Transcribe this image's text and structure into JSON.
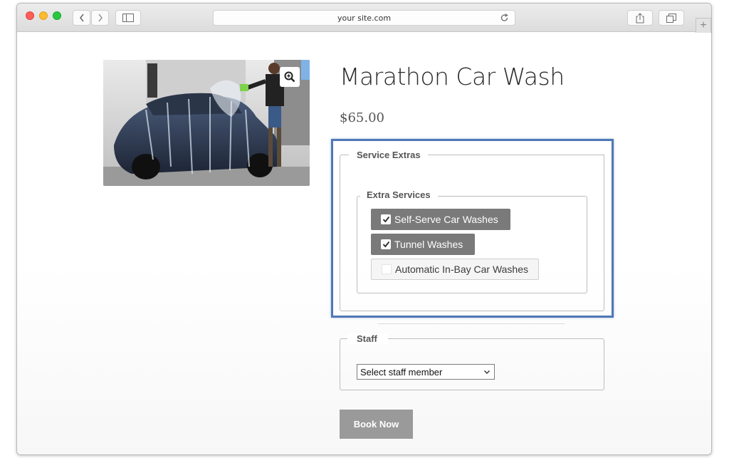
{
  "browser": {
    "url": "your site.com"
  },
  "product": {
    "title": "Marathon Car Wash",
    "price": "$65.00",
    "image_alt": "Person washing a car with a foam sprayer"
  },
  "service_extras": {
    "legend": "Service Extras",
    "extra_services": {
      "legend": "Extra Services",
      "options": [
        {
          "label": "Self-Serve Car Washes",
          "checked": true
        },
        {
          "label": "Tunnel Washes",
          "checked": true
        },
        {
          "label": "Automatic In-Bay Car Washes",
          "checked": false
        }
      ]
    }
  },
  "staff": {
    "legend": "Staff",
    "select_value": "Select staff member"
  },
  "actions": {
    "book_label": "Book Now"
  },
  "colors": {
    "highlight_border": "#4f78b5",
    "checked_option_bg": "#7a7a7a",
    "book_button_bg": "#9a9a9a"
  }
}
